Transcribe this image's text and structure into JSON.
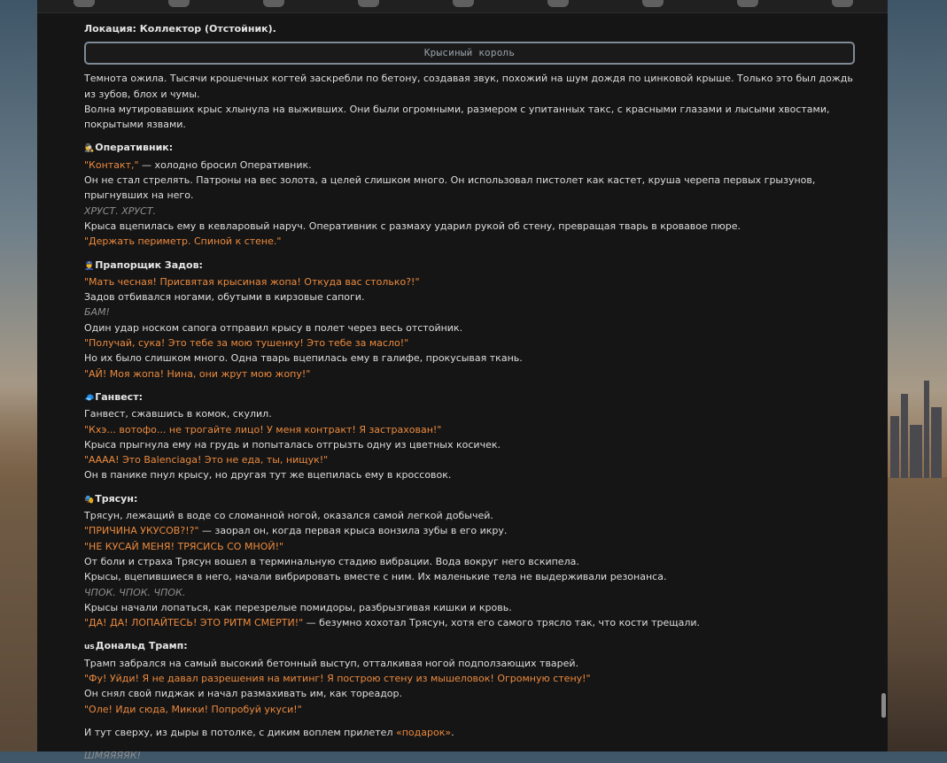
{
  "location": "Локация: Коллектор (Отстойник).",
  "scene_title": "Крысиный король",
  "intro": [
    "Темнота ожила. Тысячи крошечных когтей заскребли по бетону, создавая звук, похожий на шум дождя по цинковой крыше. Только это был дождь из зубов, блох и чумы.",
    "Волна мутировавших крыс хлынула на выживших. Они были огромными, размером с упитанных такс, с красными глазами и лысыми хвостами, покрытыми язвами."
  ],
  "sections": [
    {
      "emoji": "🕵️",
      "name": "Оперативник:",
      "lines": [
        {
          "t": "say",
          "text": "\"Контакт,\"",
          "tail": " — холодно бросил Оперативник."
        },
        {
          "t": "n",
          "text": "Он не стал стрелять. Патроны на вес золота, а целей слишком много. Он использовал пистолет как кастет, круша черепа первых грызунов, прыгнувших на него."
        },
        {
          "t": "snd",
          "text": "ХРУСТ. ХРУСТ."
        },
        {
          "t": "n",
          "text": "Крыса вцепилась ему в кевларовый наруч. Оперативник с размаху ударил рукой об стену, превращая тварь в кровавое пюре."
        },
        {
          "t": "say",
          "text": "\"Держать периметр. Спиной к стене.\""
        }
      ]
    },
    {
      "emoji": "👮",
      "name": "Прапорщик Задов:",
      "lines": [
        {
          "t": "say",
          "text": "\"Мать чесная! Присвятая крысиная жопа! Откуда вас столько?!\""
        },
        {
          "t": "n",
          "text": "Задов отбивался ногами, обутыми в кирзовые сапоги."
        },
        {
          "t": "snd",
          "text": "БАМ!"
        },
        {
          "t": "n",
          "text": "Один удар носком сапога отправил крысу в полет через весь отстойник."
        },
        {
          "t": "say",
          "text": "\"Получай, сука! Это тебе за мою тушенку! Это тебе за масло!\""
        },
        {
          "t": "n",
          "text": "Но их было слишком много. Одна тварь вцепилась ему в галифе, прокусывая ткань."
        },
        {
          "t": "say",
          "text": "\"АЙ! Моя жопа! Нина, они жрут мою жопу!\""
        }
      ]
    },
    {
      "emoji": "🧢",
      "name": "Ганвест:",
      "lines": [
        {
          "t": "n",
          "text": "Ганвест, сжавшись в комок, скулил."
        },
        {
          "t": "say",
          "text": "\"Кхэ... вотофо... не трогайте лицо! У меня контракт! Я застрахован!\""
        },
        {
          "t": "n",
          "text": "Крыса прыгнула ему на грудь и попыталась отгрызть одну из цветных косичек."
        },
        {
          "t": "say",
          "text": "\"АААА! Это Balenciaga! Это не еда, ты, нищук!\""
        },
        {
          "t": "n",
          "text": "Он в панике пнул крысу, но другая тут же вцепилась ему в кроссовок."
        }
      ]
    },
    {
      "emoji": "🎭",
      "name": "Трясун:",
      "lines": [
        {
          "t": "n",
          "text": "Трясун, лежащий в воде со сломанной ногой, оказался самой легкой добычей."
        },
        {
          "t": "say",
          "text": "\"ПРИЧИНА УКУСОВ?!?\"",
          "tail": " — заорал он, когда первая крыса вонзила зубы в его икру."
        },
        {
          "t": "say",
          "text": "\"НЕ КУСАЙ МЕНЯ! ТРЯСИСЬ СО МНОЙ!\""
        },
        {
          "t": "n",
          "text": "От боли и страха Трясун вошел в терминальную стадию вибрации. Вода вокруг него вскипела."
        },
        {
          "t": "n",
          "text": "Крысы, вцепившиеся в него, начали вибрировать вместе с ним. Их маленькие тела не выдерживали резонанса."
        },
        {
          "t": "snd",
          "text": "ЧПОК. ЧПОК. ЧПОК."
        },
        {
          "t": "n",
          "text": "Крысы начали лопаться, как перезрелые помидоры, разбрызгивая кишки и кровь."
        },
        {
          "t": "say",
          "text": "\"ДА! ДА! ЛОПАЙТЕСЬ! ЭТО РИТМ СМЕРТИ!\"",
          "tail": " — безумно хохотал Трясун, хотя его самого трясло так, что кости трещали."
        }
      ]
    },
    {
      "emoji": "us",
      "name": "Дональд Трамп:",
      "lines": [
        {
          "t": "n",
          "text": "Трамп забрался на самый высокий бетонный выступ, отталкивая ногой подползающих тварей."
        },
        {
          "t": "say",
          "text": "\"Фу! Уйди! Я не давал разрешения на митинг! Я построю стену из мышеловок! Огромную стену!\""
        },
        {
          "t": "n",
          "text": "Он снял свой пиджак и начал размахивать им, как тореадор."
        },
        {
          "t": "say",
          "text": "\"Оле! Иди сюда, Микки! Попробуй укуси!\""
        }
      ]
    }
  ],
  "outro": {
    "text": "И тут сверху, из дыры в потолке, с диким воплем прилетел ",
    "link": "«подарок»",
    "end": "."
  },
  "final_sound": "ШМЯЯЯЯК!"
}
